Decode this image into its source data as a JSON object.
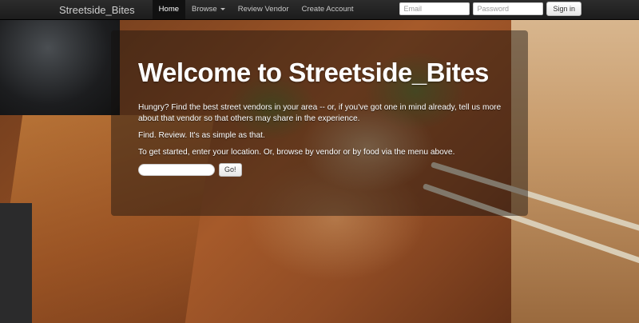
{
  "navbar": {
    "brand": "Streetside_Bites",
    "items": [
      {
        "label": "Home",
        "active": true
      },
      {
        "label": "Browse",
        "dropdown": true
      },
      {
        "label": "Review Vendor"
      },
      {
        "label": "Create Account"
      }
    ],
    "email_placeholder": "Email",
    "password_placeholder": "Password",
    "signin_label": "Sign in"
  },
  "hero": {
    "title": "Welcome to Streetside_Bites",
    "paragraph1": "Hungry? Find the best street vendors in your area -- or, if you've got one in mind already, tell us more about that vendor so that others may share in the experience.",
    "paragraph2": "Find. Review. It's as simple as that.",
    "paragraph3": "To get started, enter your location. Or, browse by vendor or by food via the menu above.",
    "location_value": "",
    "go_label": "Go!"
  },
  "icons": {
    "browse_caret": "chevron-down-icon"
  }
}
